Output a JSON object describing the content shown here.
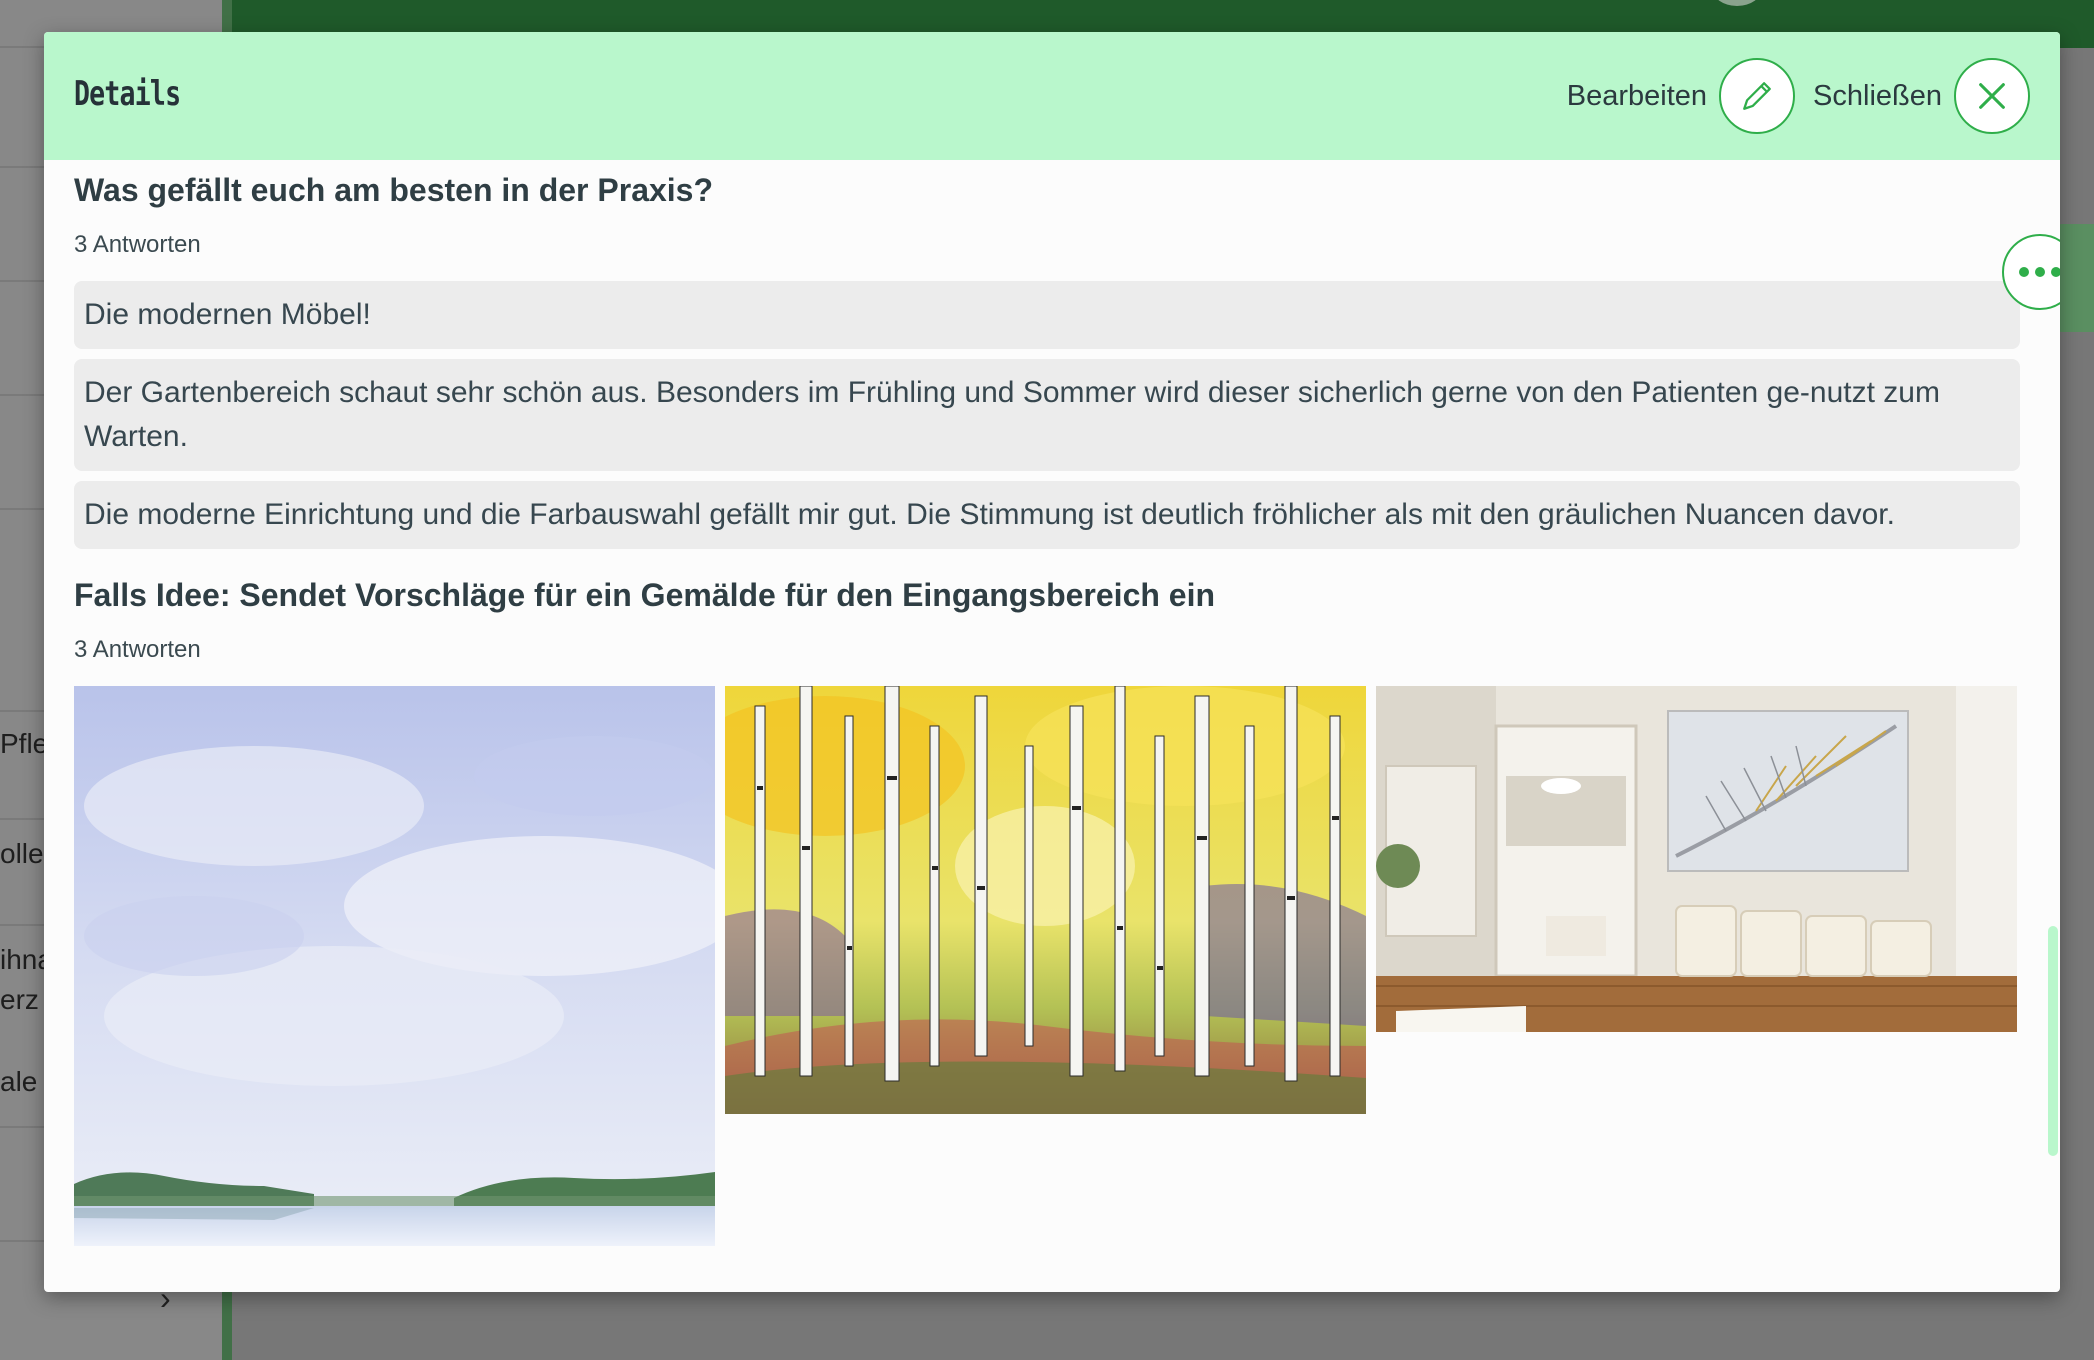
{
  "background": {
    "sidebar_fragments": [
      "Pfle",
      "olleg",
      "ihna",
      "erz",
      "ale"
    ]
  },
  "modal": {
    "title": "Details",
    "edit_label": "Bearbeiten",
    "close_label": "Schließen",
    "colors": {
      "header_bg": "#b9f7cc",
      "accent": "#2fae4a"
    }
  },
  "questions": [
    {
      "title": "Was gefällt euch am besten in der Praxis?",
      "count": "3 Antworten",
      "answers": [
        "Die modernen Möbel!",
        "Der Gartenbereich schaut sehr schön aus. Besonders im Frühling und Sommer wird dieser sicherlich gerne von den Patienten ge-nutzt zum Warten.",
        "Die moderne Einrichtung und die Farbauswahl gefällt mir gut. Die Stimmung ist deutlich fröhlicher als mit den gräulichen Nuancen davor."
      ]
    },
    {
      "title": "Falls Idee: Sendet Vorschläge für ein Gemälde für den Eingangsbereich ein",
      "count": "3 Antworten",
      "images": [
        "sky-landscape-painting",
        "birch-forest-painting",
        "waiting-room-photo"
      ]
    }
  ]
}
